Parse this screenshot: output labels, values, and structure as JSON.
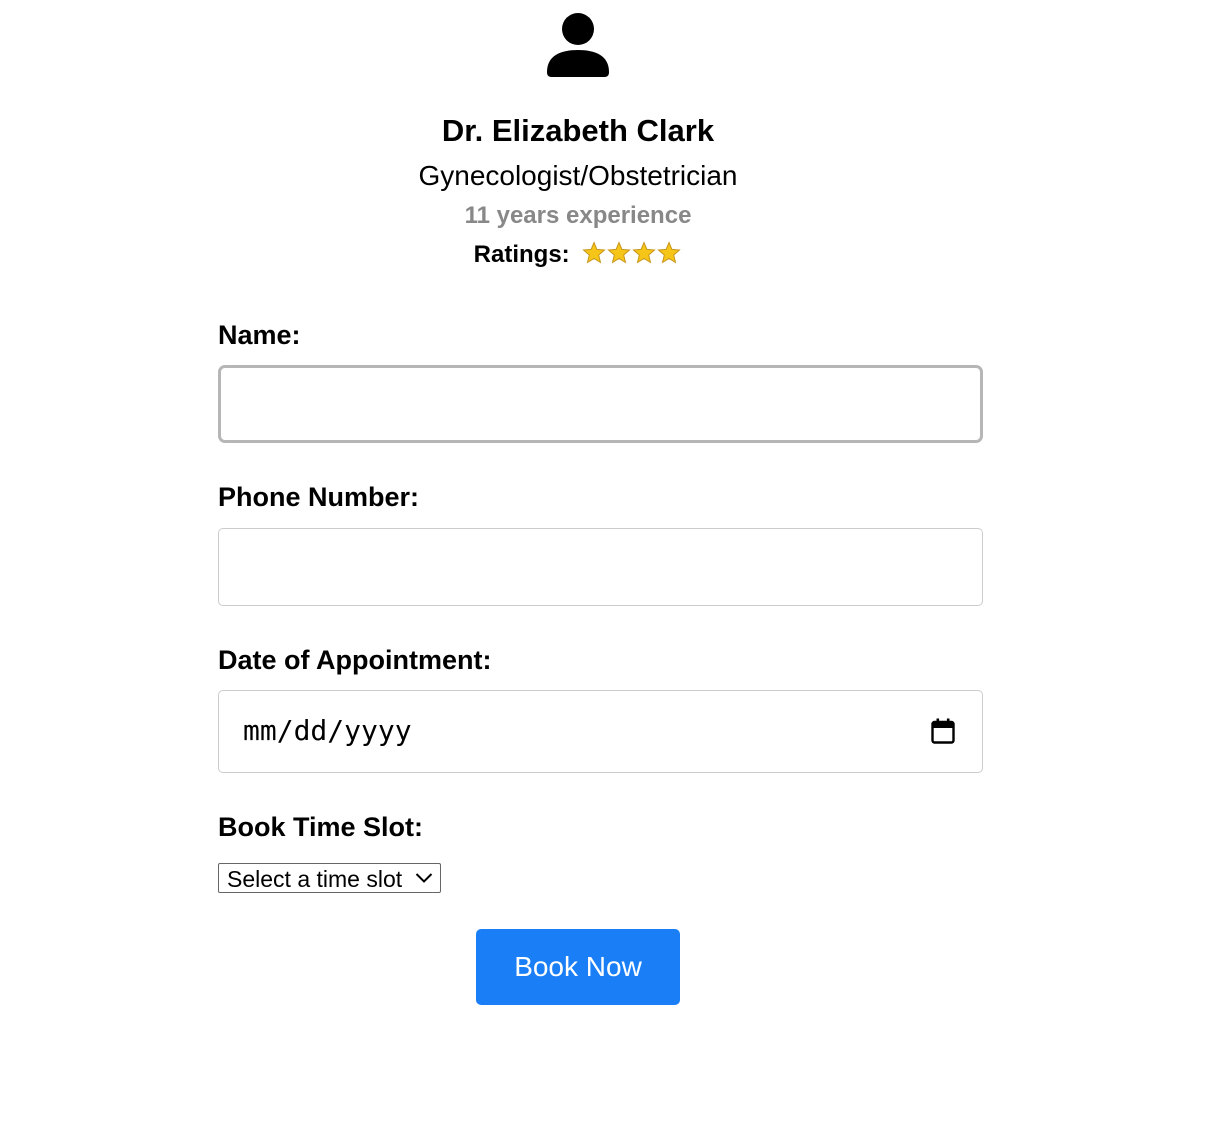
{
  "doctor": {
    "avatar_icon": "person-icon",
    "name": "Dr. Elizabeth Clark",
    "specialty": "Gynecologist/Obstetrician",
    "experience": "11 years experience",
    "ratings_label": "Ratings:",
    "rating_stars": 4,
    "rating_max": 4,
    "star_color": "#f5c518"
  },
  "form": {
    "name_label": "Name:",
    "name_value": "",
    "phone_label": "Phone Number:",
    "phone_value": "",
    "date_label": "Date of Appointment:",
    "date_placeholder": "mm/dd/yyyy",
    "date_icon": "calendar-icon",
    "time_label": "Book Time Slot:",
    "time_selected": "Select a time slot",
    "submit_label": "Book Now"
  },
  "colors": {
    "accent": "#1a7ff7",
    "muted_text": "#888888"
  }
}
